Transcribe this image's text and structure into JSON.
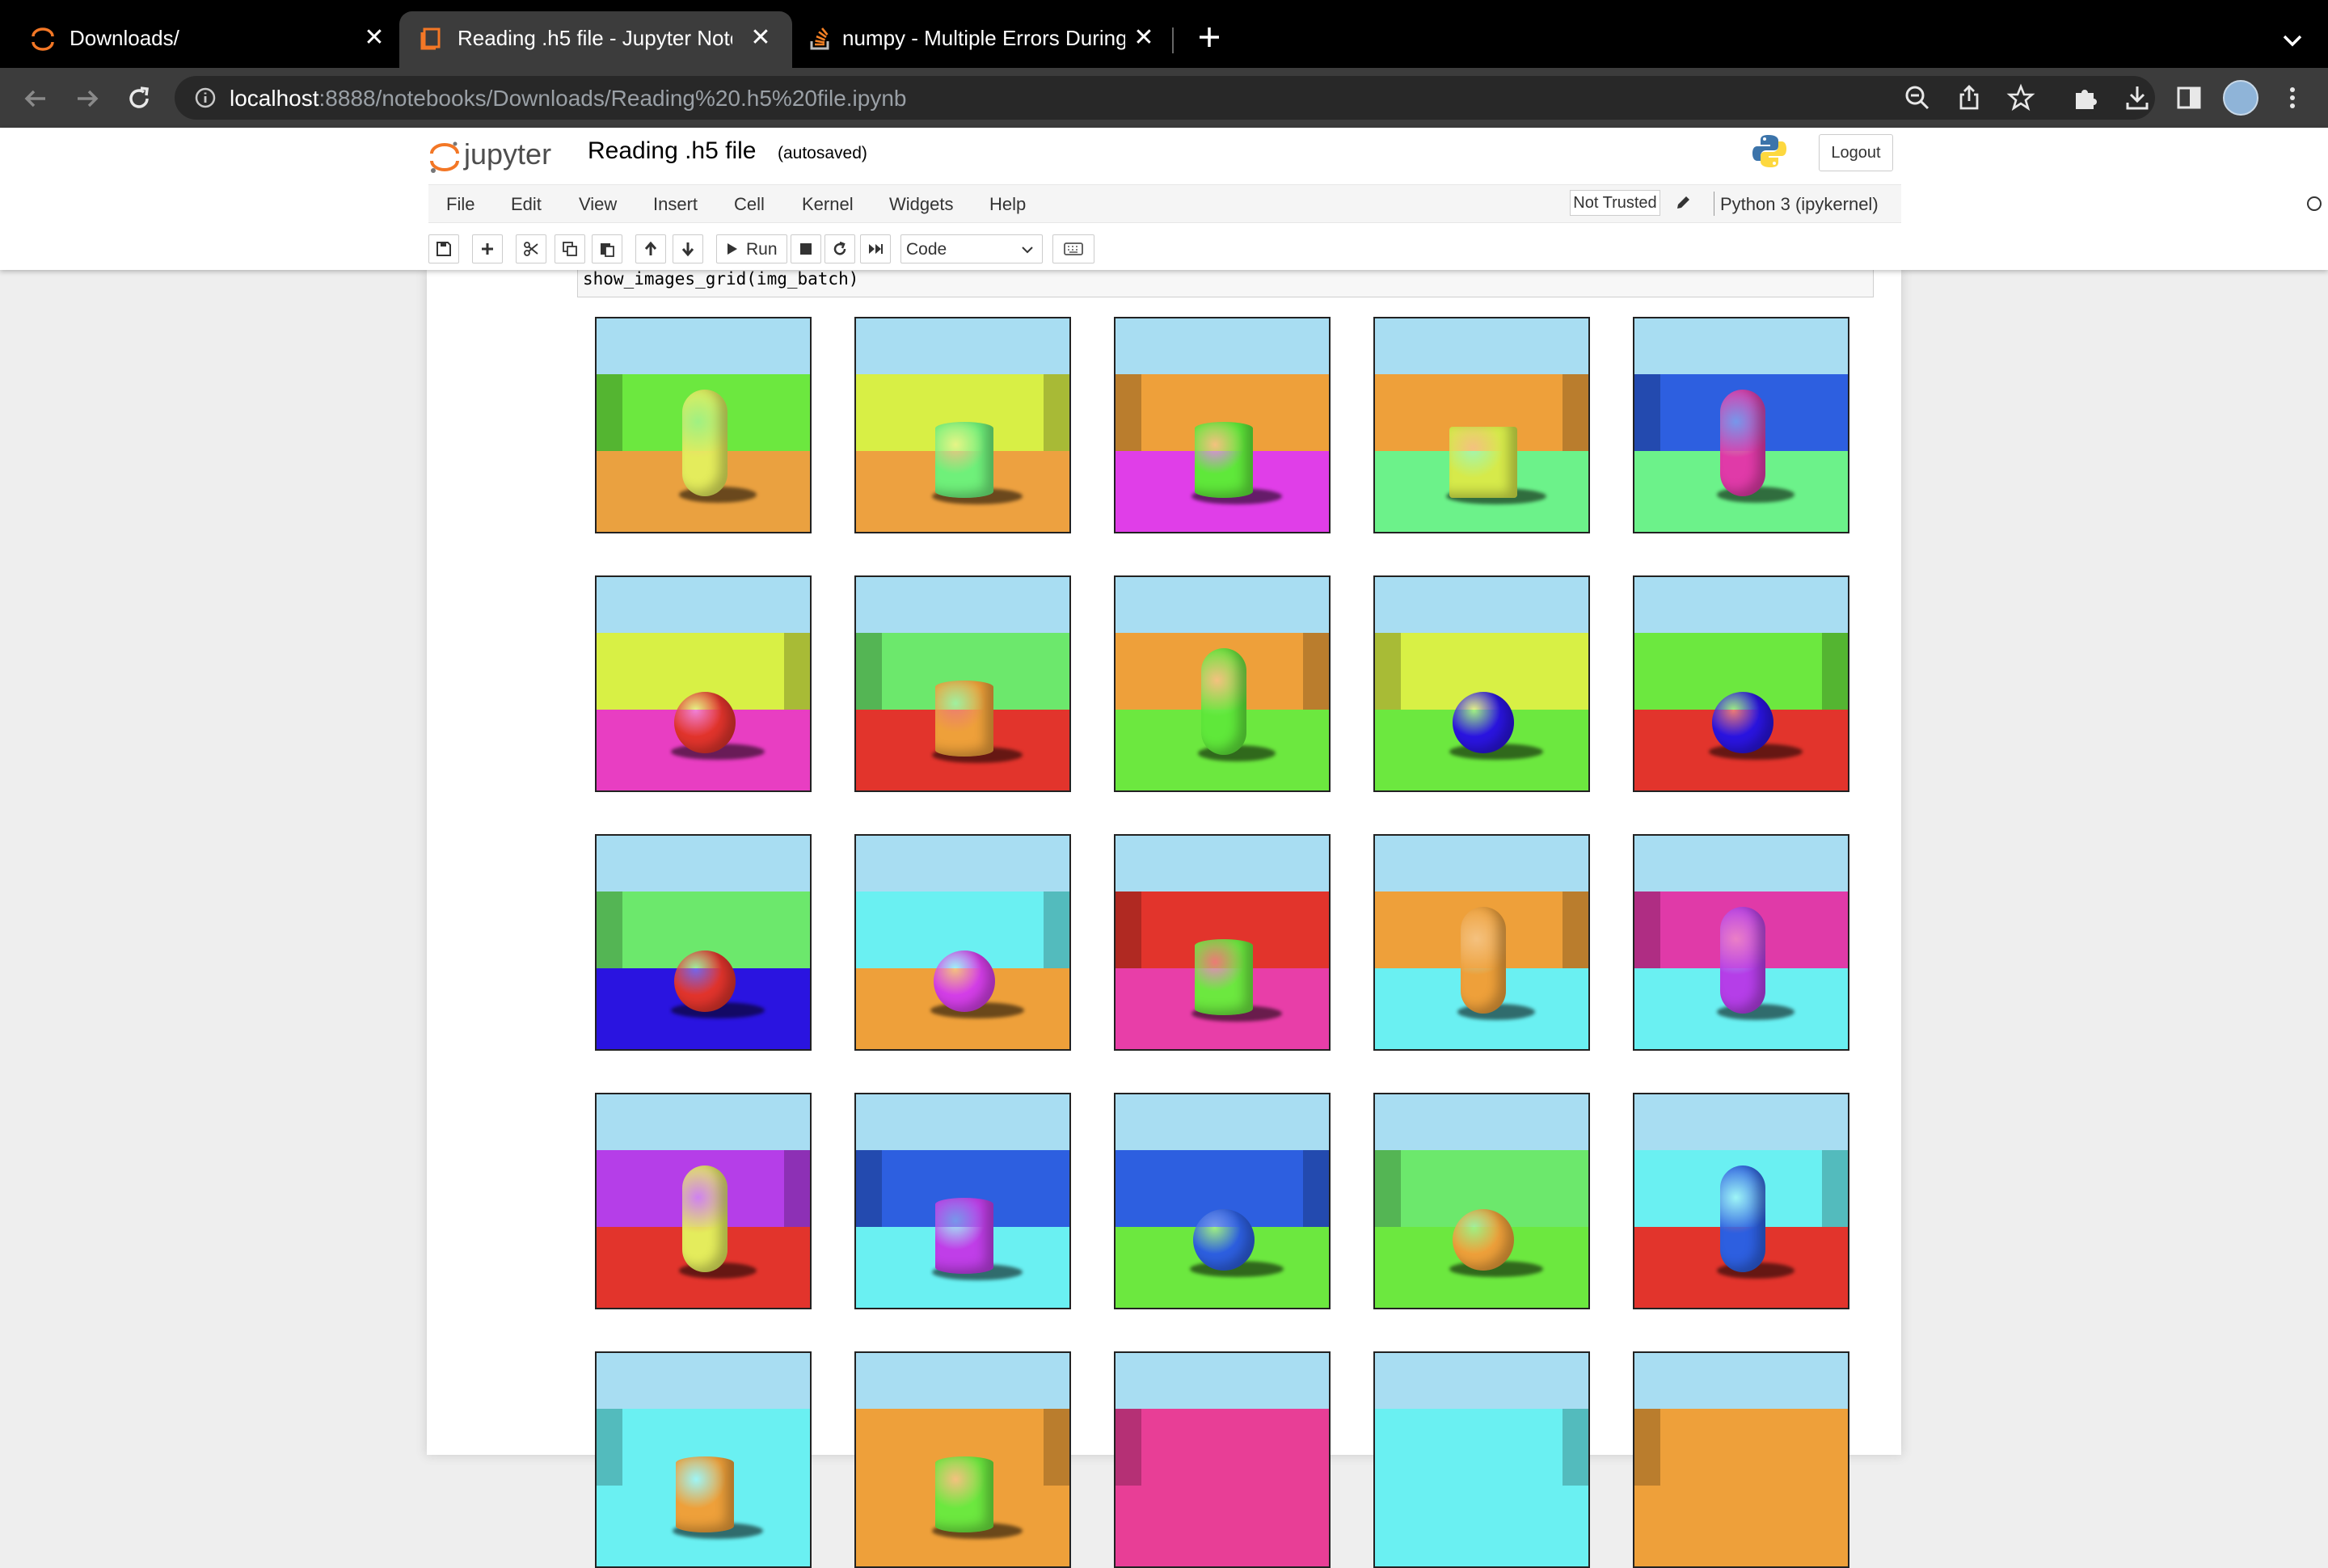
{
  "browser": {
    "tabs": [
      {
        "title": "Downloads/",
        "icon": "jupyter-icon",
        "active": false
      },
      {
        "title": "Reading .h5 file - Jupyter Note",
        "icon": "notebook-icon",
        "active": true
      },
      {
        "title": "numpy - Multiple Errors During",
        "icon": "stackoverflow-icon",
        "active": false
      }
    ],
    "url_host": "localhost",
    "url_rest": ":8888/notebooks/Downloads/Reading%20.h5%20file.ipynb"
  },
  "jupyter": {
    "logo_text": "jupyter",
    "notebook_title": "Reading .h5 file",
    "autosave_status": "(autosaved)",
    "logout_label": "Logout",
    "menu": [
      "File",
      "Edit",
      "View",
      "Insert",
      "Cell",
      "Kernel",
      "Widgets",
      "Help"
    ],
    "trust_status": "Not Trusted",
    "kernel_name": "Python 3 (ipykernel)",
    "toolbar": {
      "run_label": "Run",
      "cell_type": "Code"
    }
  },
  "cell": {
    "code": "show_images_grid(img_batch)"
  },
  "image_grid": {
    "columns": 5,
    "rows_visible": 5,
    "colors": {
      "sky": "#a8ddf2"
    },
    "images": [
      {
        "wall": "#6ce83f",
        "floor": "#eaa140",
        "object": "capsule",
        "object_color": "#e4ec5c"
      },
      {
        "wall": "#d8ef45",
        "floor": "#eda140",
        "object": "cylinder",
        "object_color": "#6ff07a"
      },
      {
        "wall": "#eea03a",
        "floor": "#e03ee8",
        "object": "cylinder",
        "object_color": "#5fe83a"
      },
      {
        "wall": "#eea03a",
        "floor": "#6cf28a",
        "object": "cube",
        "object_color": "#d6ea4a"
      },
      {
        "wall": "#2d5fe0",
        "floor": "#6cf28a",
        "object": "capsule",
        "object_color": "#e03aa8"
      },
      {
        "wall": "#d8f045",
        "floor": "#e83ec2",
        "object": "sphere",
        "object_color": "#e2342c"
      },
      {
        "wall": "#6ce86c",
        "floor": "#e2342c",
        "object": "cylinder",
        "object_color": "#eea03a"
      },
      {
        "wall": "#eea03a",
        "floor": "#6ce83f",
        "object": "capsule",
        "object_color": "#5fe83a"
      },
      {
        "wall": "#d8f045",
        "floor": "#6ce83f",
        "object": "sphere",
        "object_color": "#2a14e0"
      },
      {
        "wall": "#6ce83f",
        "floor": "#e2342c",
        "object": "sphere",
        "object_color": "#2a14e0"
      },
      {
        "wall": "#6ce86c",
        "floor": "#2a14e0",
        "object": "sphere",
        "object_color": "#e2342c"
      },
      {
        "wall": "#6af0f2",
        "floor": "#eea03a",
        "object": "sphere",
        "object_color": "#d43ee8"
      },
      {
        "wall": "#e2342c",
        "floor": "#e83ea8",
        "object": "cylinder",
        "object_color": "#6ce83f"
      },
      {
        "wall": "#eea03a",
        "floor": "#6af0f2",
        "object": "capsule",
        "object_color": "#eea03a"
      },
      {
        "wall": "#e03aa8",
        "floor": "#6af0f2",
        "object": "capsule",
        "object_color": "#b53ee8"
      },
      {
        "wall": "#b53ee8",
        "floor": "#e2342c",
        "object": "capsule",
        "object_color": "#e4ec5c"
      },
      {
        "wall": "#2d5fe0",
        "floor": "#6af0f2",
        "object": "cylinder",
        "object_color": "#c03ee8"
      },
      {
        "wall": "#2d5fe0",
        "floor": "#6ce83f",
        "object": "sphere",
        "object_color": "#2d5fe0"
      },
      {
        "wall": "#6ce86c",
        "floor": "#6ce83f",
        "object": "sphere",
        "object_color": "#eea03a"
      },
      {
        "wall": "#6af0f2",
        "floor": "#e2342c",
        "object": "capsule",
        "object_color": "#2d5fe0"
      },
      {
        "wall": "#6af0f2",
        "floor": "#6af0f2",
        "object": "cylinder",
        "object_color": "#eea03a"
      },
      {
        "wall": "#eea03a",
        "floor": "#eea03a",
        "object": "cylinder",
        "object_color": "#6ce83f"
      },
      {
        "wall": "#e83e96",
        "floor": "#e83e96",
        "object": "none",
        "object_color": "#e83e96"
      },
      {
        "wall": "#6af0f2",
        "floor": "#6af0f2",
        "object": "none",
        "object_color": "#6af0f2"
      },
      {
        "wall": "#eea03a",
        "floor": "#eea03a",
        "object": "none",
        "object_color": "#eea03a"
      }
    ]
  }
}
